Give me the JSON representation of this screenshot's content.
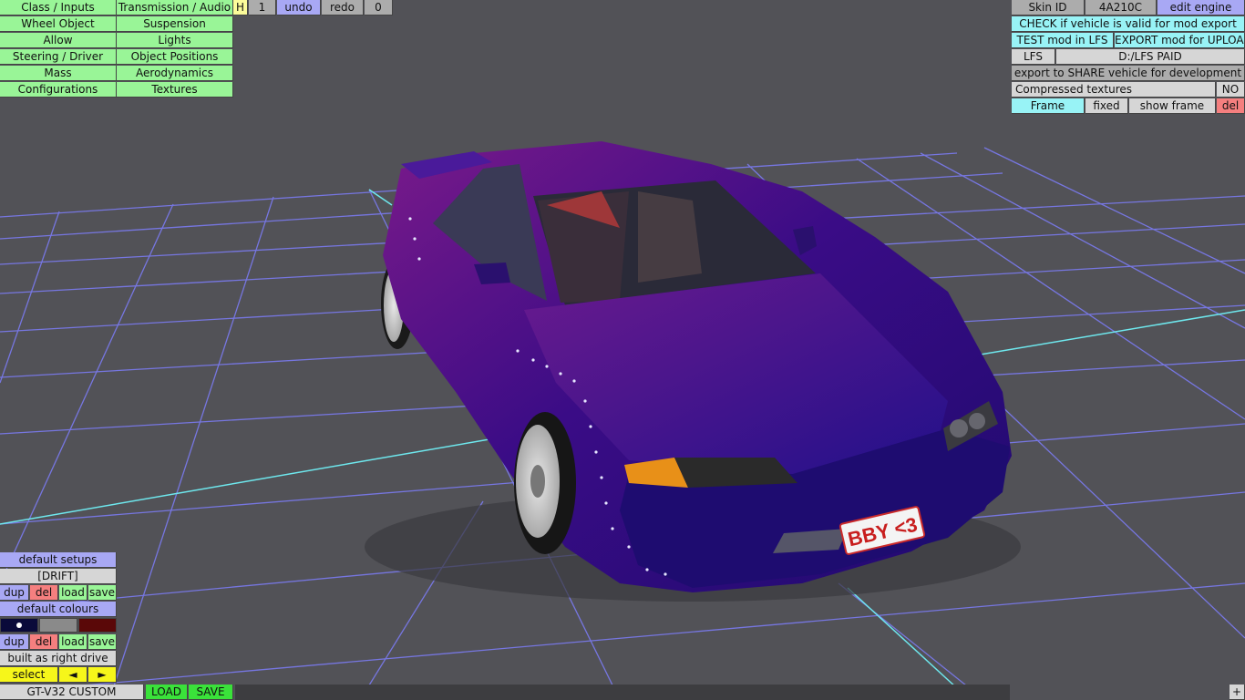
{
  "top_menu": {
    "col1": [
      "Class / Inputs",
      "Wheel Object",
      "Allow",
      "Steering / Driver",
      "Mass",
      "Configurations"
    ],
    "col2": [
      "Transmission / Audio",
      "Suspension",
      "Lights",
      "Object Positions",
      "Aerodynamics",
      "Textures"
    ],
    "h_toggle": "H",
    "undo_count": "1",
    "undo": "undo",
    "redo": "redo",
    "redo_count": "0"
  },
  "right_panel": {
    "skin_id_label": "Skin ID",
    "skin_id_value": "4A210C",
    "edit_engine": "edit engine",
    "check_valid": "CHECK if vehicle is valid for mod export",
    "test_mod": "TEST mod in LFS",
    "export_mod": "EXPORT mod for UPLOAD",
    "lfs_label": "LFS",
    "lfs_path": "D:/LFS PAID",
    "export_share": "export to SHARE vehicle for development",
    "compressed_label": "Compressed textures",
    "compressed_value": "NO",
    "frame": "Frame",
    "fixed": "fixed",
    "show_frame": "show frame",
    "del": "del"
  },
  "bottom_left": {
    "default_setups": "default setups",
    "setup_name": "[DRIFT]",
    "dup": "dup",
    "del": "del",
    "load": "load",
    "save": "save",
    "default_colours": "default colours",
    "built_as": "built as right drive",
    "select": "select",
    "prev": "◄",
    "next": "►"
  },
  "bottom_bar": {
    "vehicle_name": "GT-V32 CUSTOM",
    "load": "LOAD",
    "save": "SAVE",
    "plus": "+"
  },
  "plate": {
    "text": "BBY <3"
  },
  "colours": {
    "body": "#2a0a7a",
    "swatch1": "#0a0a3a",
    "swatch2": "#8a8a8a",
    "swatch3": "#5a0808",
    "grid": "#7b7bf0"
  }
}
